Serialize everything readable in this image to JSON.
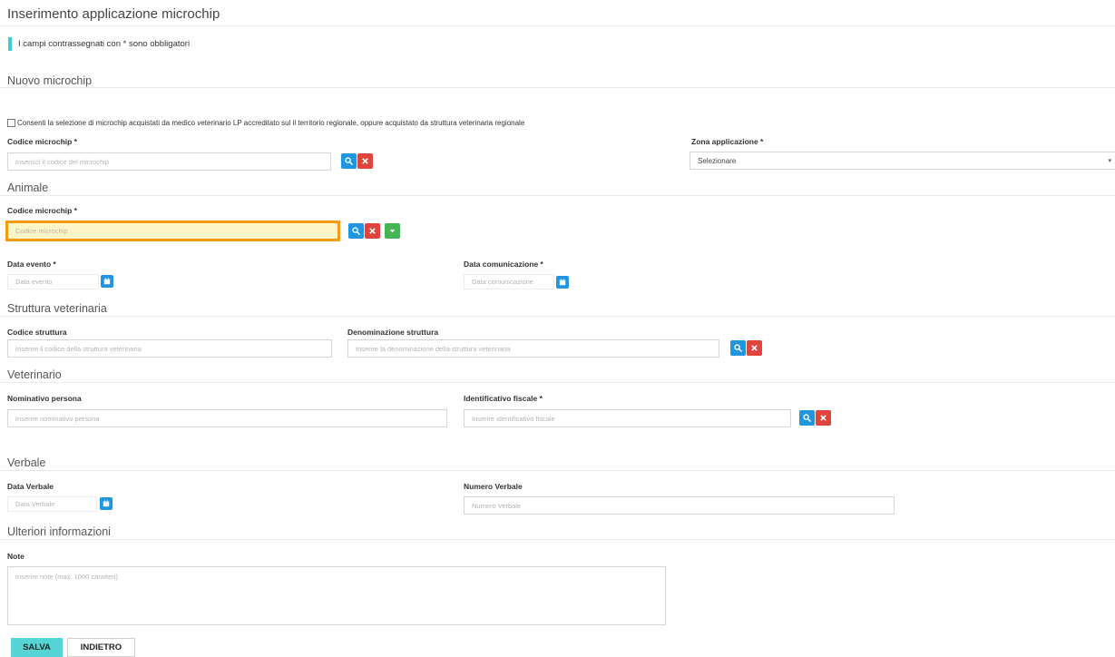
{
  "page": {
    "title": "Inserimento applicazione microchip",
    "required_note": "I campi contrassegnati con * sono obbligatori"
  },
  "nuovo_microchip": {
    "section_title": "Nuovo microchip",
    "consent_label": "Consenti la selezione di microchip acquistati da medico veterinario LP accreditato sul il territorio regionale, oppure acquistato da struttura veterinaria regionale",
    "codice_label": "Codice microchip *",
    "codice_placeholder": "Inserisci il codice del microchip",
    "zona_label": "Zona applicazione *",
    "zona_value": "Selezionare"
  },
  "animale": {
    "section_title": "Animale",
    "codice_label": "Codice microchip *",
    "codice_placeholder": "Codice microchip",
    "data_evento_label": "Data evento *",
    "data_evento_placeholder": "Data evento",
    "data_comunicazione_label": "Data comunicazione *",
    "data_comunicazione_placeholder": "Data comunicazione"
  },
  "struttura": {
    "section_title": "Struttura veterinaria",
    "codice_label": "Codice struttura",
    "codice_placeholder": "Inserire il codice della struttura veterinaria",
    "denominazione_label": "Denominazione struttura",
    "denominazione_placeholder": "Inserire la denominazione della struttura veterinaria"
  },
  "veterinario": {
    "section_title": "Veterinario",
    "nominativo_label": "Nominativo persona",
    "nominativo_placeholder": "Inserire nominativo persona",
    "cf_label": "Identificativo fiscale *",
    "cf_placeholder": "Inserire identificativo fiscale"
  },
  "verbale": {
    "section_title": "Verbale",
    "data_label": "Data Verbale",
    "data_placeholder": "Data Verbale",
    "numero_label": "Numero Verbale",
    "numero_placeholder": "Numero Verbale"
  },
  "ulteriori": {
    "section_title": "Ulteriori informazioni",
    "note_label": "Note",
    "note_placeholder": "Inserire note (max. 1000 caratteri)"
  },
  "actions": {
    "save": "SALVA",
    "back": "INDIETRO"
  },
  "icons": {
    "search": "search-icon",
    "clear": "close-icon",
    "dropdown": "caret-down-icon",
    "calendar": "calendar-icon"
  },
  "colors": {
    "accent": "#55d4d5",
    "blue": "#2196e0",
    "red": "#e0443d",
    "green": "#44b454",
    "focus": "#f39c12"
  }
}
